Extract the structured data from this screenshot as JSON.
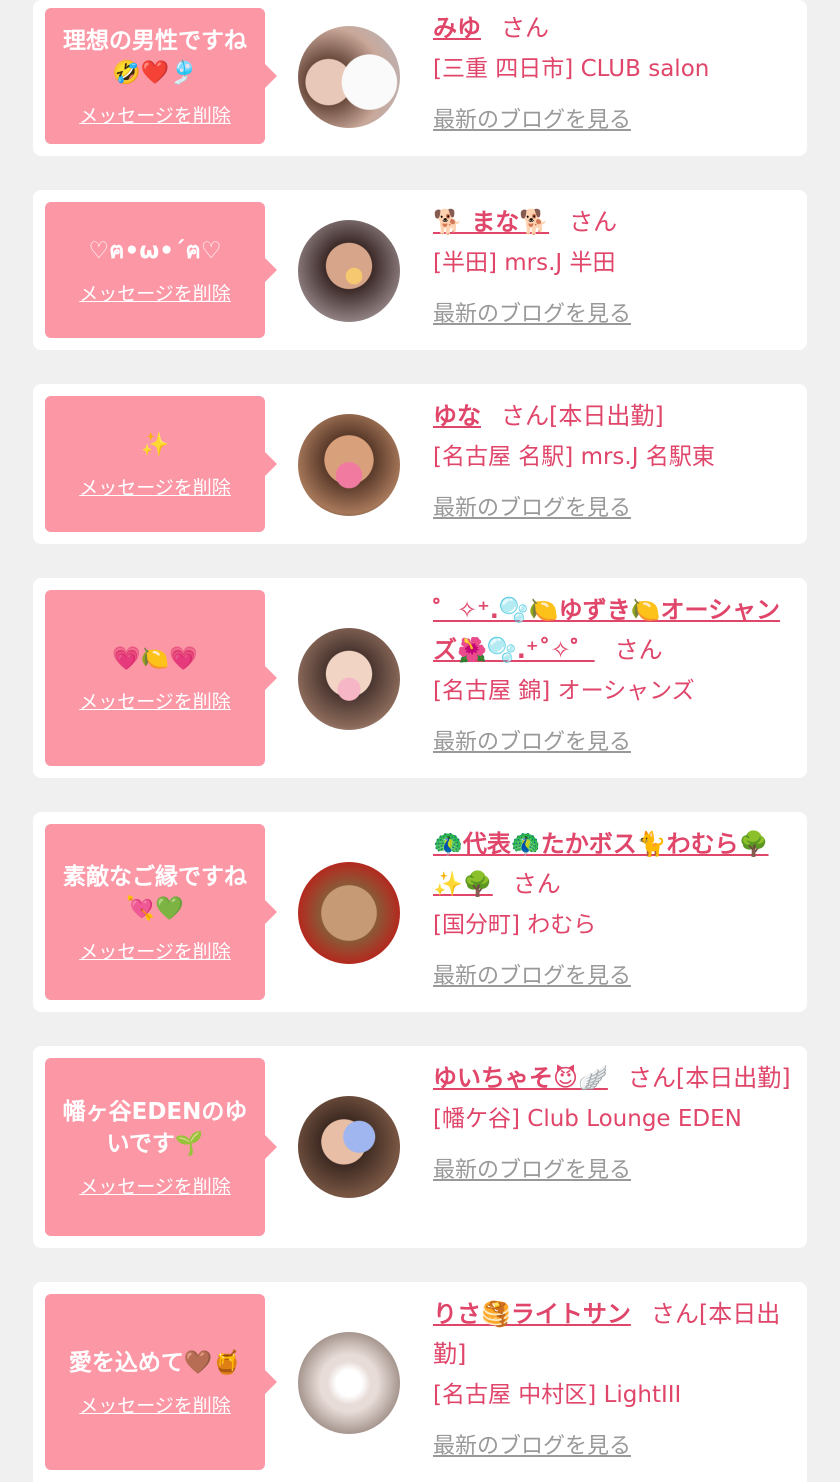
{
  "delete_label": "メッセージを削除",
  "blog_label": "最新のブログを見る",
  "cards": [
    {
      "message": "理想の男性ですね🤣❤️🎐",
      "name": "みゆ",
      "suffix": "さん",
      "shop": "[三重 四日市] CLUB salon"
    },
    {
      "message": "♡ฅ•ω•´ฅ♡",
      "name": "🐕 まな🐕",
      "suffix": "さん",
      "shop": "[半田] mrs.J 半田"
    },
    {
      "message": "✨",
      "name": "ゆな",
      "suffix": "さん[本日出勤]",
      "shop": "[名古屋 名駅] mrs.J 名駅東"
    },
    {
      "message": "💗🍋💗",
      "name": "゜✧⁺.🫧🍋ゆずき🍋オーシャンズ🌺🫧.⁺˚✧゜",
      "suffix": "さん",
      "shop": "[名古屋 錦] オーシャンズ"
    },
    {
      "message": "素敵なご縁ですね 💘💚",
      "name": "🦚代表🦚たかボス🐈わむら🌳✨🌳",
      "suffix": "さん",
      "shop": "[国分町] わむら"
    },
    {
      "message": "幡ヶ谷EDENのゆいです🌱",
      "name": "ゆいちゃそ😈🪽",
      "suffix": "さん[本日出勤]",
      "shop": "[幡ケ谷] Club Lounge EDEN"
    },
    {
      "message": "愛を込めて🤎🍯",
      "name": "りさ🥞ライトサン",
      "suffix": "さん[本日出勤]",
      "shop": "[名古屋 中村区] LightIII"
    }
  ]
}
